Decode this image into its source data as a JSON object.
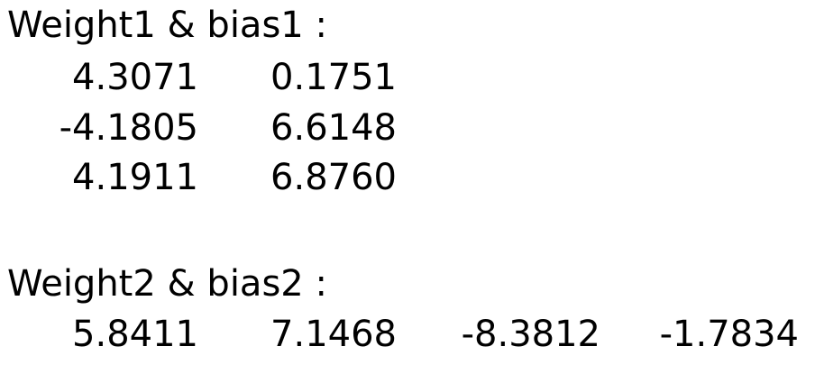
{
  "section1": {
    "heading": "Weight1 & bias1 :",
    "rows": [
      [
        "4.3071",
        "0.1751"
      ],
      [
        "-4.1805",
        "6.6148"
      ],
      [
        "4.1911",
        "6.8760"
      ]
    ]
  },
  "section2": {
    "heading": "Weight2 & bias2 :",
    "rows": [
      [
        "5.8411",
        "7.1468",
        "-8.3812",
        "-1.7834"
      ]
    ]
  }
}
